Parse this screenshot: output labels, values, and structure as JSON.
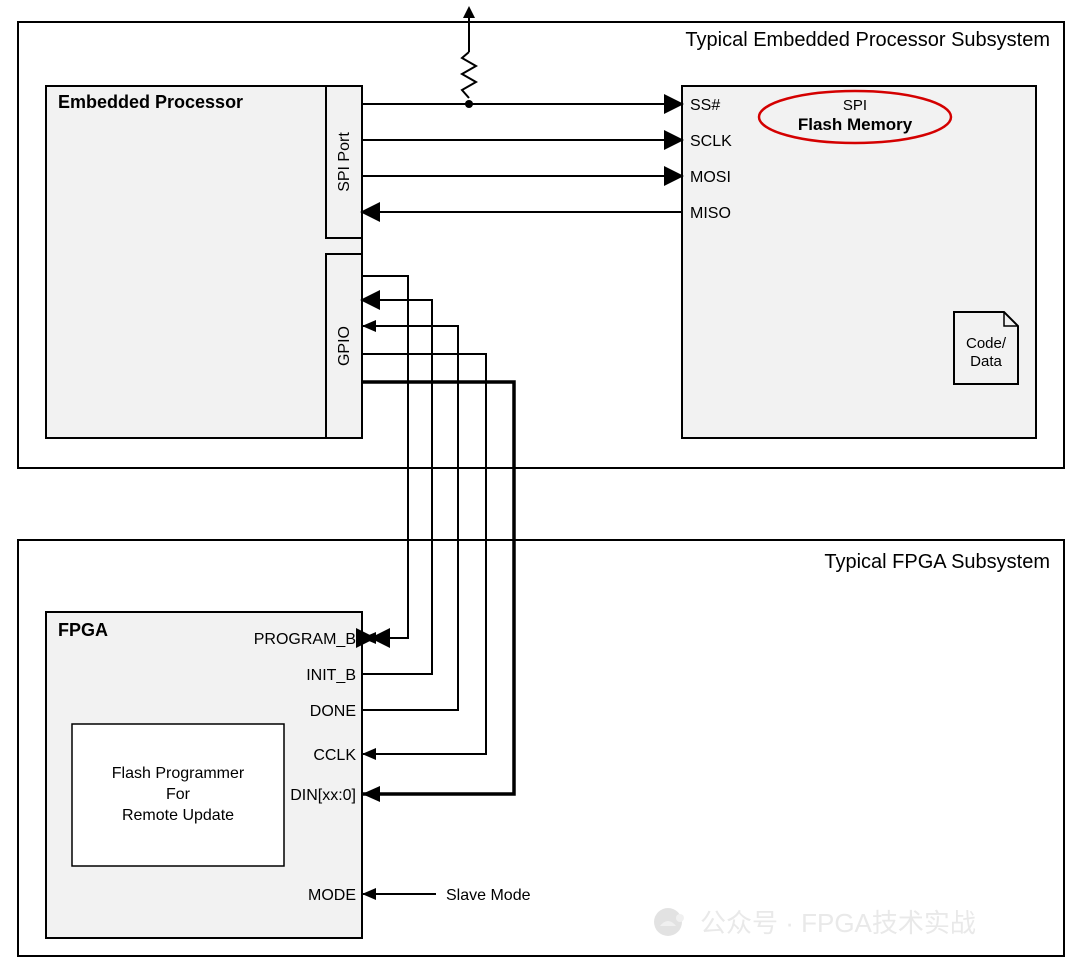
{
  "diagram": {
    "top_subsystem_title": "Typical Embedded Processor Subsystem",
    "bottom_subsystem_title": "Typical FPGA Subsystem",
    "processor": {
      "title": "Embedded Processor",
      "ports": {
        "spi": "SPI Port",
        "gpio": "GPIO"
      }
    },
    "flash": {
      "label_top": "SPI",
      "label_bold": "Flash Memory",
      "doc_line1": "Code/",
      "doc_line2": "Data",
      "signals": {
        "ss": "SS#",
        "sclk": "SCLK",
        "mosi": "MOSI",
        "miso": "MISO"
      }
    },
    "fpga": {
      "title": "FPGA",
      "inner_line1": "Flash Programmer",
      "inner_line2": "For",
      "inner_line3": "Remote Update",
      "signals": {
        "program_b": "PROGRAM_B",
        "init_b": "INIT_B",
        "done": "DONE",
        "cclk": "CCLK",
        "din": "DIN[xx:0]",
        "mode": "MODE"
      },
      "slave_mode": "Slave Mode"
    },
    "watermark": "公众号 · FPGA技术实战"
  }
}
